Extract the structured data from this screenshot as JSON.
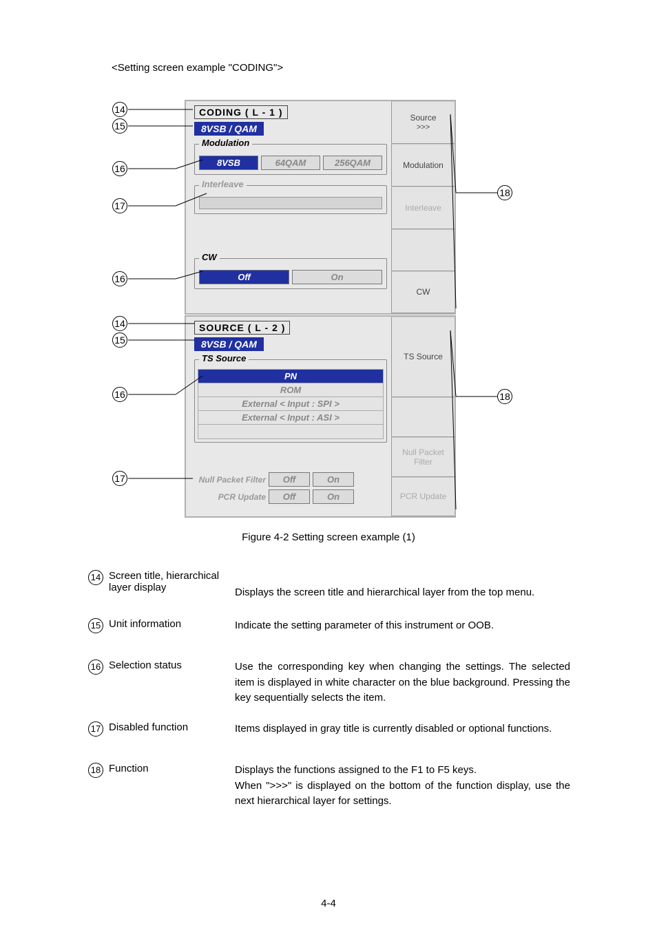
{
  "caption_top": "<Setting screen example \"CODING\">",
  "coding": {
    "title": "CODING ( L - 1 )",
    "unit": "8VSB / QAM",
    "modulation_label": "Modulation",
    "modulation_opts": [
      "8VSB",
      "64QAM",
      "256QAM"
    ],
    "interleave_label": "Interleave",
    "cw_label": "CW",
    "cw_opts": [
      "Off",
      "On"
    ],
    "fns": {
      "source": "Source",
      "source_sub": ">>>",
      "modulation": "Modulation",
      "interleave": "Interleave",
      "cw": "CW"
    }
  },
  "source": {
    "title": "SOURCE ( L - 2 )",
    "unit": "8VSB / QAM",
    "ts_label": "TS Source",
    "ts_items": [
      "PN",
      "ROM",
      "External < Input : SPI >",
      "External < Input : ASI >"
    ],
    "npf_label": "Null Packet Filter",
    "pcr_label": "PCR Update",
    "off": "Off",
    "on": "On",
    "fns": {
      "ts": "TS Source",
      "npf1": "Null Packet",
      "npf2": "Filter",
      "pcr": "PCR Update"
    }
  },
  "figure_caption": "Figure 4-2    Setting screen example (1)",
  "desc": {
    "i14": {
      "term1": "Screen title, hierarchical",
      "term2": "layer display",
      "body": "Displays the screen title and hierarchical layer from the top menu."
    },
    "i15": {
      "term": "Unit information",
      "body": "Indicate the setting parameter of this instrument or OOB."
    },
    "i16": {
      "term": "Selection status",
      "body": "Use the corresponding key when changing the settings.   The selected item is displayed in white character on the blue background.   Pressing the key sequentially selects the item."
    },
    "i17": {
      "term": "Disabled function",
      "body": "Items displayed in gray title is currently disabled or optional functions."
    },
    "i18": {
      "term": "Function",
      "body1": "Displays the functions assigned to the F1 to F5 keys.",
      "body2": "When \">>>\" is displayed on the bottom of the function display, use the next hierarchical layer for settings."
    }
  },
  "pagenum": "4-4"
}
